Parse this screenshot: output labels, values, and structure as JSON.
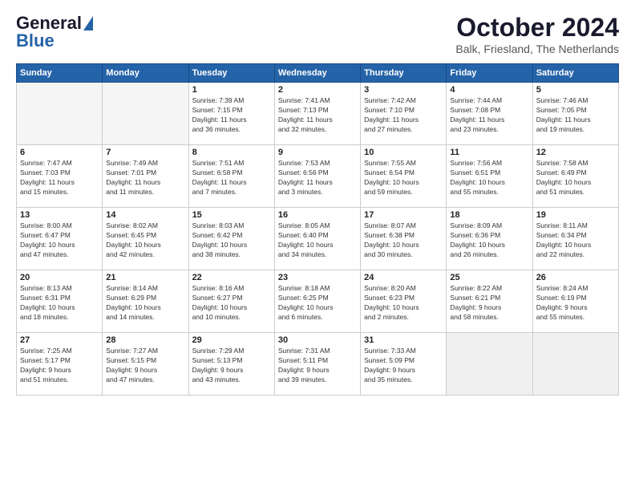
{
  "header": {
    "logo_line1": "General",
    "logo_line2": "Blue",
    "month": "October 2024",
    "location": "Balk, Friesland, The Netherlands"
  },
  "weekdays": [
    "Sunday",
    "Monday",
    "Tuesday",
    "Wednesday",
    "Thursday",
    "Friday",
    "Saturday"
  ],
  "weeks": [
    [
      {
        "day": "",
        "info": ""
      },
      {
        "day": "",
        "info": ""
      },
      {
        "day": "1",
        "info": "Sunrise: 7:39 AM\nSunset: 7:15 PM\nDaylight: 11 hours\nand 36 minutes."
      },
      {
        "day": "2",
        "info": "Sunrise: 7:41 AM\nSunset: 7:13 PM\nDaylight: 11 hours\nand 32 minutes."
      },
      {
        "day": "3",
        "info": "Sunrise: 7:42 AM\nSunset: 7:10 PM\nDaylight: 11 hours\nand 27 minutes."
      },
      {
        "day": "4",
        "info": "Sunrise: 7:44 AM\nSunset: 7:08 PM\nDaylight: 11 hours\nand 23 minutes."
      },
      {
        "day": "5",
        "info": "Sunrise: 7:46 AM\nSunset: 7:05 PM\nDaylight: 11 hours\nand 19 minutes."
      }
    ],
    [
      {
        "day": "6",
        "info": "Sunrise: 7:47 AM\nSunset: 7:03 PM\nDaylight: 11 hours\nand 15 minutes."
      },
      {
        "day": "7",
        "info": "Sunrise: 7:49 AM\nSunset: 7:01 PM\nDaylight: 11 hours\nand 11 minutes."
      },
      {
        "day": "8",
        "info": "Sunrise: 7:51 AM\nSunset: 6:58 PM\nDaylight: 11 hours\nand 7 minutes."
      },
      {
        "day": "9",
        "info": "Sunrise: 7:53 AM\nSunset: 6:56 PM\nDaylight: 11 hours\nand 3 minutes."
      },
      {
        "day": "10",
        "info": "Sunrise: 7:55 AM\nSunset: 6:54 PM\nDaylight: 10 hours\nand 59 minutes."
      },
      {
        "day": "11",
        "info": "Sunrise: 7:56 AM\nSunset: 6:51 PM\nDaylight: 10 hours\nand 55 minutes."
      },
      {
        "day": "12",
        "info": "Sunrise: 7:58 AM\nSunset: 6:49 PM\nDaylight: 10 hours\nand 51 minutes."
      }
    ],
    [
      {
        "day": "13",
        "info": "Sunrise: 8:00 AM\nSunset: 6:47 PM\nDaylight: 10 hours\nand 47 minutes."
      },
      {
        "day": "14",
        "info": "Sunrise: 8:02 AM\nSunset: 6:45 PM\nDaylight: 10 hours\nand 42 minutes."
      },
      {
        "day": "15",
        "info": "Sunrise: 8:03 AM\nSunset: 6:42 PM\nDaylight: 10 hours\nand 38 minutes."
      },
      {
        "day": "16",
        "info": "Sunrise: 8:05 AM\nSunset: 6:40 PM\nDaylight: 10 hours\nand 34 minutes."
      },
      {
        "day": "17",
        "info": "Sunrise: 8:07 AM\nSunset: 6:38 PM\nDaylight: 10 hours\nand 30 minutes."
      },
      {
        "day": "18",
        "info": "Sunrise: 8:09 AM\nSunset: 6:36 PM\nDaylight: 10 hours\nand 26 minutes."
      },
      {
        "day": "19",
        "info": "Sunrise: 8:11 AM\nSunset: 6:34 PM\nDaylight: 10 hours\nand 22 minutes."
      }
    ],
    [
      {
        "day": "20",
        "info": "Sunrise: 8:13 AM\nSunset: 6:31 PM\nDaylight: 10 hours\nand 18 minutes."
      },
      {
        "day": "21",
        "info": "Sunrise: 8:14 AM\nSunset: 6:29 PM\nDaylight: 10 hours\nand 14 minutes."
      },
      {
        "day": "22",
        "info": "Sunrise: 8:16 AM\nSunset: 6:27 PM\nDaylight: 10 hours\nand 10 minutes."
      },
      {
        "day": "23",
        "info": "Sunrise: 8:18 AM\nSunset: 6:25 PM\nDaylight: 10 hours\nand 6 minutes."
      },
      {
        "day": "24",
        "info": "Sunrise: 8:20 AM\nSunset: 6:23 PM\nDaylight: 10 hours\nand 2 minutes."
      },
      {
        "day": "25",
        "info": "Sunrise: 8:22 AM\nSunset: 6:21 PM\nDaylight: 9 hours\nand 58 minutes."
      },
      {
        "day": "26",
        "info": "Sunrise: 8:24 AM\nSunset: 6:19 PM\nDaylight: 9 hours\nand 55 minutes."
      }
    ],
    [
      {
        "day": "27",
        "info": "Sunrise: 7:25 AM\nSunset: 5:17 PM\nDaylight: 9 hours\nand 51 minutes."
      },
      {
        "day": "28",
        "info": "Sunrise: 7:27 AM\nSunset: 5:15 PM\nDaylight: 9 hours\nand 47 minutes."
      },
      {
        "day": "29",
        "info": "Sunrise: 7:29 AM\nSunset: 5:13 PM\nDaylight: 9 hours\nand 43 minutes."
      },
      {
        "day": "30",
        "info": "Sunrise: 7:31 AM\nSunset: 5:11 PM\nDaylight: 9 hours\nand 39 minutes."
      },
      {
        "day": "31",
        "info": "Sunrise: 7:33 AM\nSunset: 5:09 PM\nDaylight: 9 hours\nand 35 minutes."
      },
      {
        "day": "",
        "info": ""
      },
      {
        "day": "",
        "info": ""
      }
    ]
  ]
}
